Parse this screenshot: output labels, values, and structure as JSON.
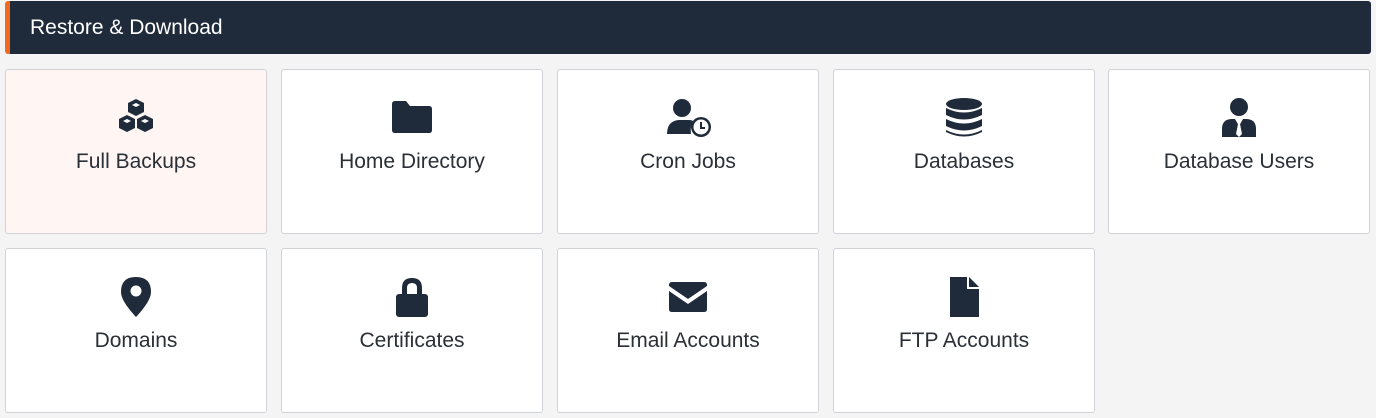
{
  "header": {
    "title": "Restore & Download",
    "accent_color": "#f26a21",
    "background_color": "#1f2b3a"
  },
  "tiles": [
    {
      "label": "Full Backups",
      "icon": "cubes-icon",
      "selected": true
    },
    {
      "label": "Home Directory",
      "icon": "folder-icon"
    },
    {
      "label": "Cron Jobs",
      "icon": "user-clock-icon"
    },
    {
      "label": "Databases",
      "icon": "database-icon"
    },
    {
      "label": "Database Users",
      "icon": "user-tie-icon"
    },
    {
      "label": "Domains",
      "icon": "map-marker-icon"
    },
    {
      "label": "Certificates",
      "icon": "lock-icon"
    },
    {
      "label": "Email Accounts",
      "icon": "envelope-icon"
    },
    {
      "label": "FTP Accounts",
      "icon": "file-icon"
    }
  ]
}
